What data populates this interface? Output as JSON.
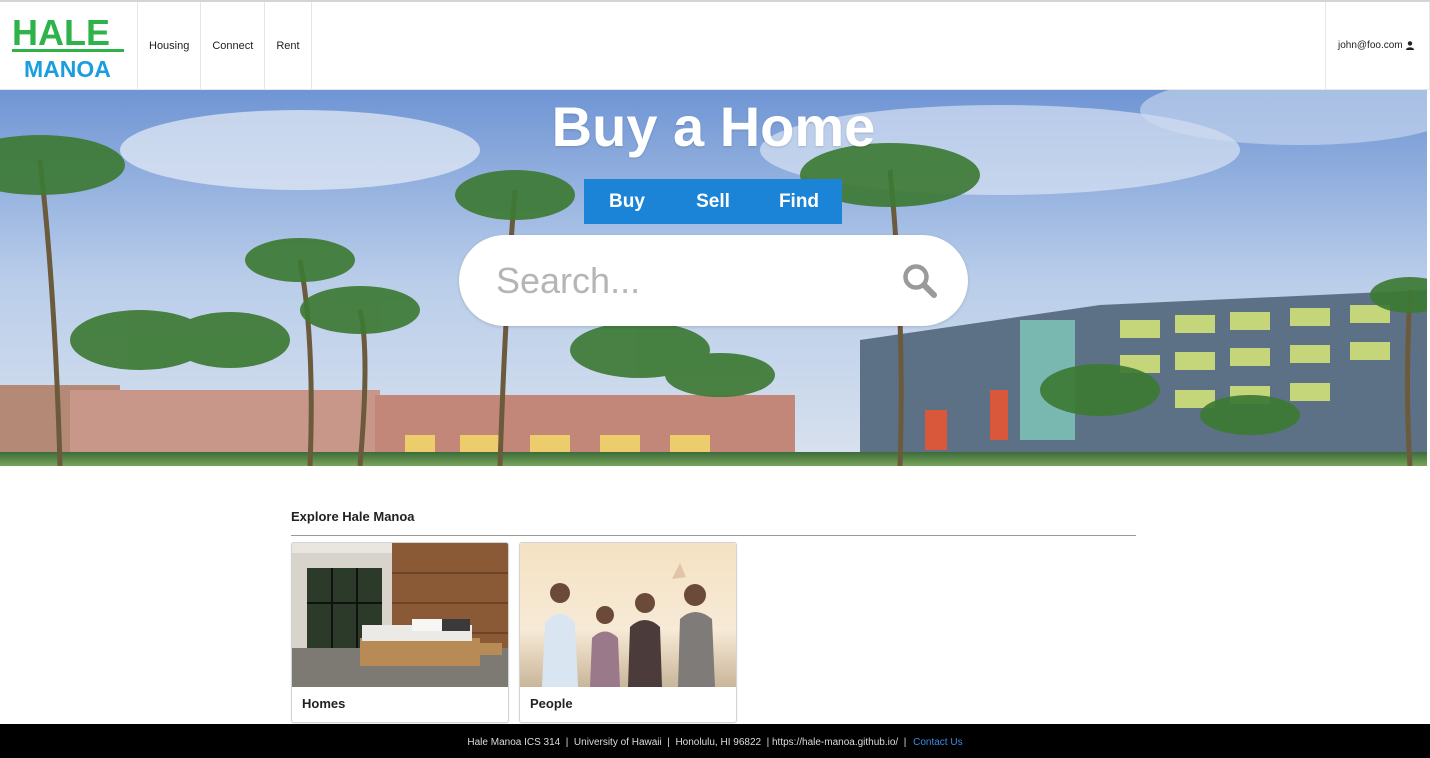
{
  "brand": {
    "line1": "HALE",
    "line2": "MANOA"
  },
  "nav": {
    "items": [
      {
        "label": "Housing"
      },
      {
        "label": "Connect"
      },
      {
        "label": "Rent"
      }
    ],
    "user": "john@foo.com",
    "user_icon": "user-icon"
  },
  "hero": {
    "title": "Buy a Home",
    "tabs": [
      {
        "label": "Buy"
      },
      {
        "label": "Sell"
      },
      {
        "label": "Find"
      }
    ],
    "search": {
      "placeholder": "Search...",
      "icon": "search-icon"
    }
  },
  "explore": {
    "heading": "Explore Hale Manoa",
    "cards": [
      {
        "label": "Homes"
      },
      {
        "label": "People"
      }
    ]
  },
  "footer": {
    "text": "Hale Manoa ICS 314  |  University of Hawaii  |  Honolulu, HI 96822  | https://hale-manoa.github.io/  | ",
    "contact_label": "Contact Us"
  },
  "colors": {
    "brand_green": "#2db34a",
    "brand_blue": "#1a9ee0",
    "tab_blue": "#1b84d6",
    "link_blue": "#3e8ce8"
  }
}
